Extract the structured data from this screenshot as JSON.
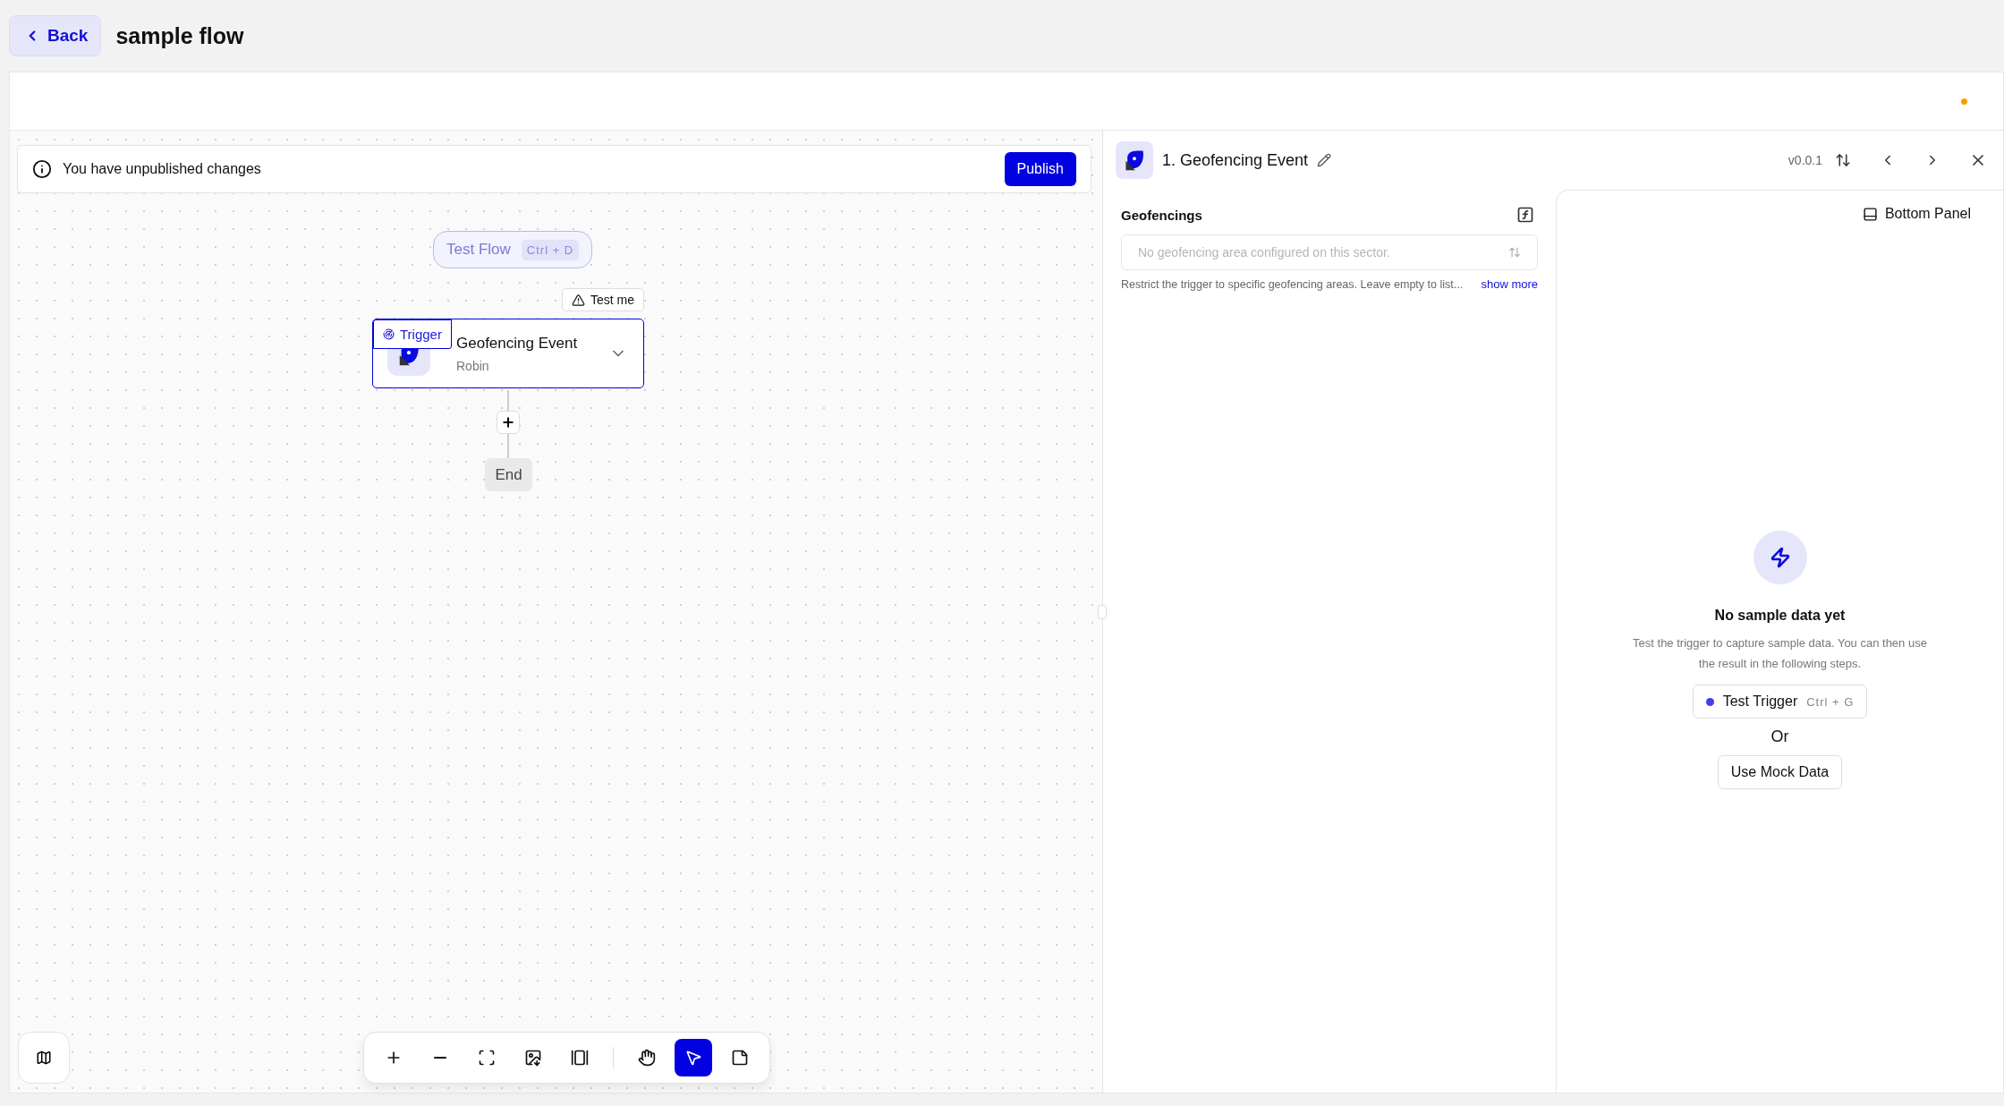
{
  "header": {
    "back_label": "Back",
    "title": "sample flow"
  },
  "banner": {
    "message": "You have unpublished changes",
    "action": "Publish"
  },
  "canvas": {
    "test_flow": {
      "label": "Test Flow",
      "shortcut": "Ctrl + D"
    },
    "test_me": "Test me",
    "step": {
      "badge": "Trigger",
      "title": "Geofencing Event",
      "subtitle": "Robin",
      "selected": true
    },
    "end_label": "End"
  },
  "toolbar": [
    {
      "kind": "zoom-in",
      "selected": false
    },
    {
      "kind": "zoom-out",
      "selected": false
    },
    {
      "kind": "fit",
      "selected": false
    },
    {
      "kind": "export",
      "selected": false
    },
    {
      "kind": "layout",
      "selected": false
    },
    {
      "kind": "pan",
      "selected": false
    },
    {
      "kind": "select",
      "selected": true
    },
    {
      "kind": "note",
      "selected": false
    }
  ],
  "panel": {
    "title": "1. Geofencing Event",
    "version": "v0.0.1",
    "field": {
      "label": "Geofencings",
      "placeholder": "No geofencing area configured on this sector.",
      "help": "Restrict the trigger to specific geofencing areas. Leave empty to list...",
      "help_link": "show more"
    },
    "bottom_panel": "Bottom Panel",
    "empty": {
      "title": "No sample data yet",
      "text": "Test the trigger to capture sample data. You can then use the result in the following steps.",
      "test_button": "Test Trigger",
      "test_shortcut": "Ctrl + G",
      "or": "Or",
      "mock_button": "Use Mock Data"
    }
  }
}
